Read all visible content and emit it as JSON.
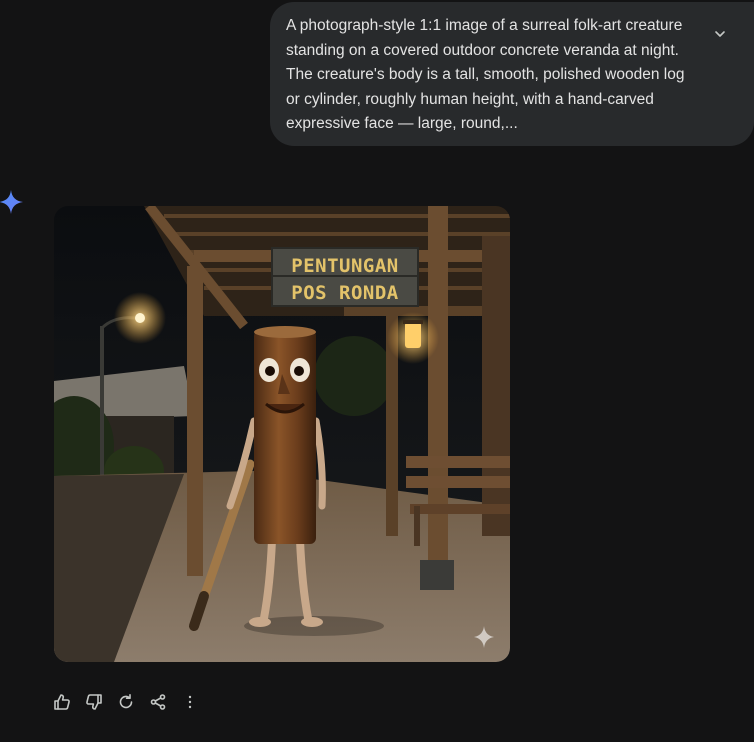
{
  "user_message": {
    "text": "A photograph-style 1:1 image of a surreal folk-art creature standing on a covered outdoor concrete veranda at night. The creature's body is a tall, smooth, polished wooden log or cylinder, roughly human height, with a hand-carved expressive face — large, round,...",
    "expand_icon": "chevron-down-icon"
  },
  "assistant": {
    "avatar_icon": "gemini-sparkle-icon",
    "image": {
      "sign_line1": "PENTUNGAN",
      "sign_line2": "POS RONDA",
      "watermark_icon": "sparkle-watermark-icon"
    }
  },
  "actions": {
    "thumbs_up_icon": "thumbs-up-icon",
    "thumbs_down_icon": "thumbs-down-icon",
    "regenerate_icon": "regenerate-icon",
    "share_icon": "share-icon",
    "more_icon": "more-options-icon"
  },
  "colors": {
    "background": "#131314",
    "bubble": "#282a2c",
    "text": "#e3e3e3",
    "gemini_blue": "#4285f4"
  }
}
